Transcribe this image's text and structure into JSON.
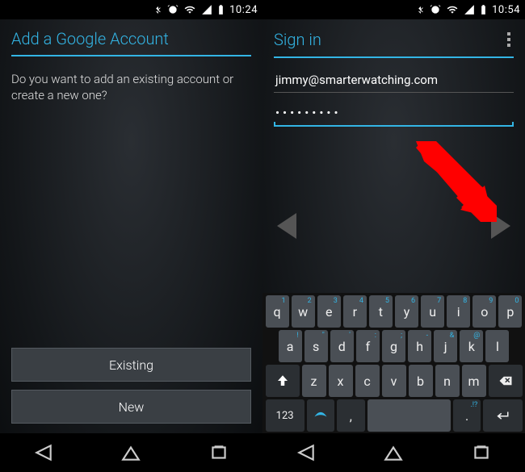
{
  "left": {
    "status_time": "10:24",
    "title": "Add a Google Account",
    "body": "Do you want to add an existing account or create a new one?",
    "btn_existing": "Existing",
    "btn_new": "New"
  },
  "right": {
    "status_time": "10:54",
    "title": "Sign in",
    "email_value": "jimmy@smarterwatching.com",
    "password_dots": "•••••••••",
    "keyboard": {
      "row1": [
        {
          "k": "q",
          "s": "1"
        },
        {
          "k": "w",
          "s": "2"
        },
        {
          "k": "e",
          "s": "3"
        },
        {
          "k": "r",
          "s": "4"
        },
        {
          "k": "t",
          "s": "5"
        },
        {
          "k": "y",
          "s": "6"
        },
        {
          "k": "u",
          "s": "7"
        },
        {
          "k": "i",
          "s": "8"
        },
        {
          "k": "o",
          "s": "9"
        },
        {
          "k": "p",
          "s": "0"
        }
      ],
      "row2": [
        {
          "k": "a",
          "s": "!"
        },
        {
          "k": "s",
          "s": "\""
        },
        {
          "k": "d",
          "s": "'"
        },
        {
          "k": "f",
          "s": ":"
        },
        {
          "k": "g",
          "s": ";"
        },
        {
          "k": "h",
          "s": "-"
        },
        {
          "k": "j",
          "s": "&"
        },
        {
          "k": "k",
          "s": "@"
        },
        {
          "k": "l",
          "s": ""
        }
      ],
      "row3": [
        {
          "k": "z",
          "s": ""
        },
        {
          "k": "x",
          "s": ""
        },
        {
          "k": "c",
          "s": ""
        },
        {
          "k": "v",
          "s": ""
        },
        {
          "k": "b",
          "s": ""
        },
        {
          "k": "n",
          "s": ""
        },
        {
          "k": "m",
          "s": ""
        }
      ],
      "num_key": "123",
      "comma_key": ",",
      "space_key": " ",
      "period_key": ".",
      "period_sec": ".!?"
    }
  }
}
